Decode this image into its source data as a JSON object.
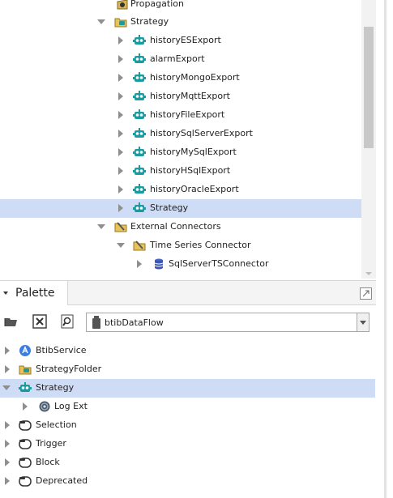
{
  "nav_tree": {
    "rows": [
      {
        "label": "Propagation",
        "icon": "folder-gear-icon",
        "toggle": "none"
      },
      {
        "label": "Strategy",
        "icon": "strategy-folder-icon",
        "toggle": "open"
      },
      {
        "label": "historyESExport",
        "icon": "component-robot-icon",
        "toggle": "closed"
      },
      {
        "label": "alarmExport",
        "icon": "component-robot-icon",
        "toggle": "closed"
      },
      {
        "label": "historyMongoExport",
        "icon": "component-robot-icon",
        "toggle": "closed"
      },
      {
        "label": "historyMqttExport",
        "icon": "component-robot-icon",
        "toggle": "closed"
      },
      {
        "label": "historyFileExport",
        "icon": "component-robot-icon",
        "toggle": "closed"
      },
      {
        "label": "historySqlServerExport",
        "icon": "component-robot-icon",
        "toggle": "closed"
      },
      {
        "label": "historyMySqlExport",
        "icon": "component-robot-icon",
        "toggle": "closed"
      },
      {
        "label": "historyHSqlExport",
        "icon": "component-robot-icon",
        "toggle": "closed"
      },
      {
        "label": "historyOracleExport",
        "icon": "component-robot-icon",
        "toggle": "closed"
      },
      {
        "label": "Strategy",
        "icon": "component-robot-icon",
        "toggle": "closed",
        "selected": true
      },
      {
        "label": "External Connectors",
        "icon": "folder-gear-icon",
        "toggle": "open"
      },
      {
        "label": "Time Series Connector",
        "icon": "folder-gear-icon",
        "toggle": "open"
      },
      {
        "label": "SqlServerTSConnector",
        "icon": "database-icon",
        "toggle": "closed"
      }
    ]
  },
  "palette": {
    "title": "Palette",
    "module_select": {
      "value": "btibDataFlow"
    },
    "tree": [
      {
        "label": "BtibService",
        "icon": "btib-service-icon",
        "toggle": "closed"
      },
      {
        "label": "StrategyFolder",
        "icon": "strategy-folder-icon",
        "toggle": "closed"
      },
      {
        "label": "Strategy",
        "icon": "component-robot-icon",
        "toggle": "open",
        "selected": true
      },
      {
        "label": "Log Ext",
        "icon": "gear-icon",
        "toggle": "closed"
      },
      {
        "label": "Selection",
        "icon": "folder-circle-icon",
        "toggle": "closed"
      },
      {
        "label": "Trigger",
        "icon": "folder-circle-icon",
        "toggle": "closed"
      },
      {
        "label": "Block",
        "icon": "folder-circle-icon",
        "toggle": "closed"
      },
      {
        "label": "Deprecated",
        "icon": "folder-circle-icon",
        "toggle": "closed"
      }
    ]
  },
  "colors": {
    "selection": "#cfdcf6",
    "robot_teal": "#1a9ba0"
  }
}
